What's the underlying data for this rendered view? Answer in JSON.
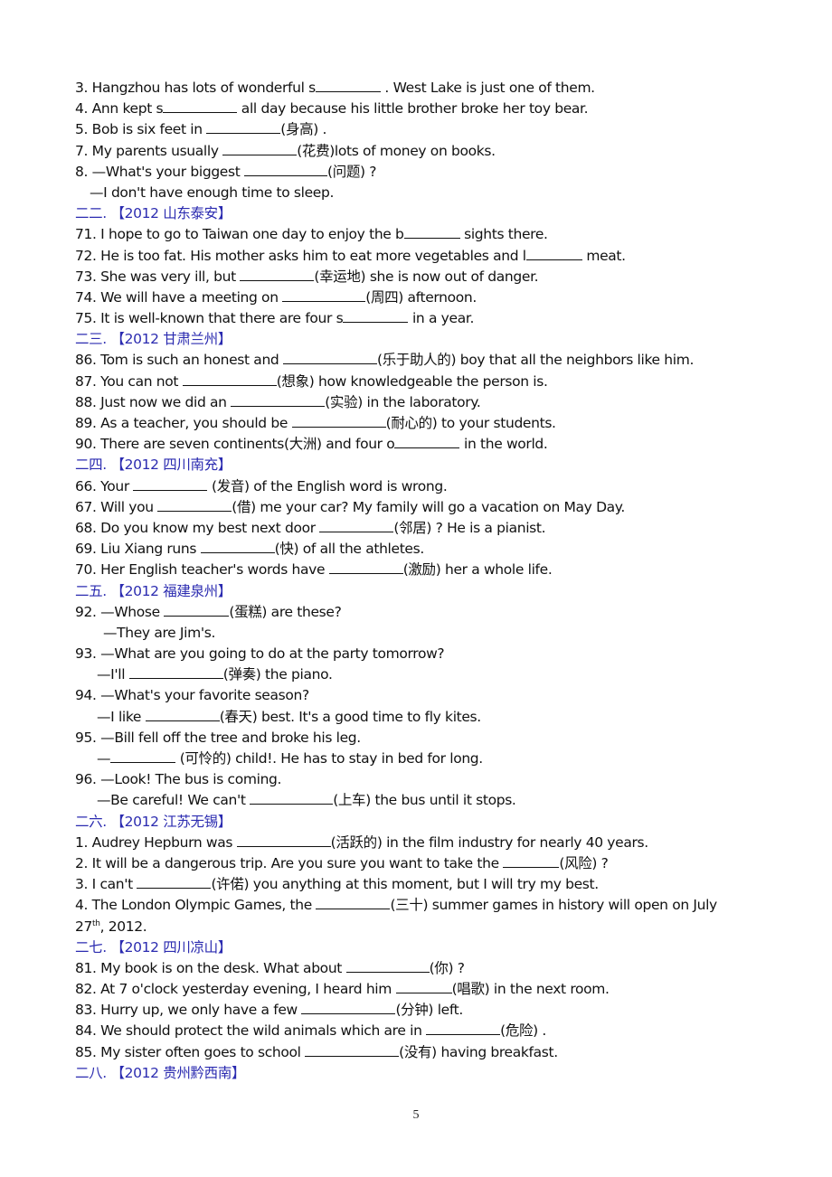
{
  "questions_intro": [
    {
      "pre": "3. Hangzhou has lots of wonderful s",
      "blank": "w9",
      "post": " . West Lake is just one of them."
    },
    {
      "pre": "4. Ann kept s",
      "blank": "w10",
      "post": " all day because his little brother broke her toy bear."
    },
    {
      "pre": "5. Bob is six feet in ",
      "blank": "w10",
      "post": "(身高) ."
    },
    {
      "pre": "7. My parents usually ",
      "blank": "w10",
      "post": "(花费)lots of money on books."
    },
    {
      "pre": "8. —What's your biggest ",
      "blank": "w11",
      "post": "(问题) ?"
    },
    {
      "pre": "—I don't have enough time to sleep.",
      "indent": "indent1"
    }
  ],
  "sections": [
    {
      "heading": "二二. 【2012 山东泰安】",
      "lines": [
        {
          "pre": "71. I hope to go to Taiwan one day to enjoy the b",
          "blank": "w8",
          "post": " sights there."
        },
        {
          "pre": "72. He is too fat. His mother asks him to eat more vegetables and l",
          "blank": "w8",
          "post": " meat."
        },
        {
          "pre": "73. She was very ill, but ",
          "blank": "w10",
          "post": "(幸运地) she is now out of danger."
        },
        {
          "pre": "74. We will have a meeting on ",
          "blank": "w11",
          "post": "(周四) afternoon."
        },
        {
          "pre": "75. It is well-known that there are four s",
          "blank": "w9",
          "post": " in a year."
        }
      ]
    },
    {
      "heading": "二三. 【2012 甘肃兰州】",
      "lines": [
        {
          "pre": "86. Tom is such an honest and ",
          "blank": "w12",
          "post": "(乐于助人的) boy that all the neighbors like him."
        },
        {
          "pre": "87. You can not ",
          "blank": "w12",
          "post": "(想象) how knowledgeable the person is."
        },
        {
          "pre": "88. Just now we did an ",
          "blank": "w12",
          "post": "(实验) in the laboratory."
        },
        {
          "pre": "89. As a teacher, you should be ",
          "blank": "w12",
          "post": "(耐心的) to your students."
        },
        {
          "pre": "90. There are seven continents(大洲) and four o",
          "blank": "w9",
          "post": " in the world."
        }
      ]
    },
    {
      "heading": "二四. 【2012 四川南充】",
      "lines": [
        {
          "pre": "66. Your ",
          "blank": "w10",
          "post": "  (发音) of the English word is wrong."
        },
        {
          "pre": "67. Will you ",
          "blank": "w10",
          "post": "(借) me your car? My family will go a vacation on May Day."
        },
        {
          "pre": "68. Do you know my best next door ",
          "blank": "w10",
          "post": "(邻居) ?  He is a pianist."
        },
        {
          "pre": "69. Liu Xiang runs ",
          "blank": "w10",
          "post": "(快) of all the athletes."
        },
        {
          "pre": "70. Her English teacher's words have ",
          "blank": "w10",
          "post": "(激励) her a whole life."
        }
      ]
    },
    {
      "heading": "二五. 【2012 福建泉州】",
      "lines": [
        {
          "pre": "92. —Whose ",
          "blank": "w9",
          "post": "(蛋糕) are these?"
        },
        {
          "pre": "—They are Jim's.",
          "indent": "indent2"
        },
        {
          "pre": "93. —What are you going to do at the party tomorrow?"
        },
        {
          "pre": "—I'll ",
          "blank": "w12",
          "post": "(弹奏) the piano.",
          "indent": "indent3"
        },
        {
          "pre": "94. —What's your favorite season?"
        },
        {
          "pre": "—I like ",
          "blank": "w10",
          "post": "(春天) best. It's a good time to fly kites.",
          "indent": "indent3"
        },
        {
          "pre": "95. —Bill fell off the tree and broke his leg."
        },
        {
          "pre": "—",
          "blank": "w9",
          "post": " (可怜的) child!. He has to stay in bed for long.",
          "indent": "indent3"
        },
        {
          "pre": "96. —Look! The bus is coming."
        },
        {
          "pre": "—Be careful! We can't ",
          "blank": "w11",
          "post": "(上车) the bus until it stops.",
          "indent": "indent3"
        }
      ]
    },
    {
      "heading": "二六. 【2012 江苏无锡】",
      "lines": [
        {
          "pre": "1. Audrey Hepburn was ",
          "blank": "w12",
          "post": "(活跃的) in the film industry for nearly 40 years."
        },
        {
          "pre": "2. It will be a dangerous trip. Are you sure you want to take the ",
          "blank": "w8",
          "post": "(风险) ?"
        },
        {
          "pre": "3. I can't ",
          "blank": "w10",
          "post": "(许偌) you anything at this moment, but I will try my best."
        },
        {
          "pre": "4. The London Olympic Games, the ",
          "blank": "w10",
          "post": "(三十) summer games in history will open on July"
        },
        {
          "pre": "27",
          "sup": "th",
          "post": ", 2012."
        }
      ]
    },
    {
      "heading": "二七. 【2012 四川凉山】",
      "lines": [
        {
          "pre": "81. My book is on the desk. What about ",
          "blank": "w11",
          "post": "(你) ?"
        },
        {
          "pre": "82. At 7 o'clock yesterday evening, I heard him ",
          "blank": "w8",
          "post": "(唱歌) in the next room."
        },
        {
          "pre": "83. Hurry up, we only have a few ",
          "blank": "w12",
          "post": "(分钟) left."
        },
        {
          "pre": "84. We should protect the wild animals which are in ",
          "blank": "w10",
          "post": "(危险) ."
        },
        {
          "pre": "85. My sister often goes to school ",
          "blank": "w12",
          "post": "(没有) having breakfast."
        }
      ]
    },
    {
      "heading": "二八. 【2012 贵州黔西南】",
      "lines": []
    }
  ],
  "page_number": "5"
}
